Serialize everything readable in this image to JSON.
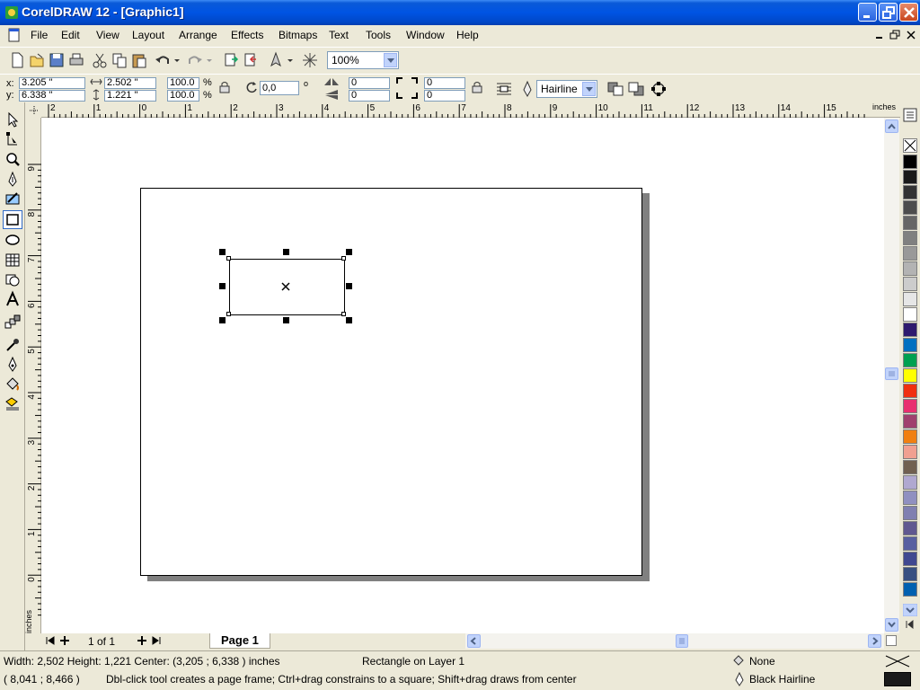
{
  "window": {
    "title": "CorelDRAW 12 - [Graphic1]"
  },
  "menu": [
    "File",
    "Edit",
    "View",
    "Layout",
    "Arrange",
    "Effects",
    "Bitmaps",
    "Text",
    "Tools",
    "Window",
    "Help"
  ],
  "toolbar": {
    "zoom": "100%"
  },
  "property_bar": {
    "x_label": "x:",
    "x": "3.205 \"",
    "y_label": "y:",
    "y": "6.338 \"",
    "width": "2.502 \"",
    "height": "1.221 \"",
    "scale_x": "100.0",
    "scale_y": "100.0",
    "percent": "%",
    "rotation": "0,0",
    "degree": "o",
    "corner_tl": "0",
    "corner_bl": "0",
    "corner_tr": "0",
    "corner_br": "0",
    "outline": "Hairline"
  },
  "rulers": {
    "unit": "inches",
    "h_ticks": [
      "2",
      "1",
      "0",
      "1",
      "2",
      "3",
      "4",
      "5",
      "6",
      "7",
      "8",
      "9",
      "10",
      "11",
      "12",
      "13",
      "14",
      "15"
    ],
    "v_ticks": [
      "9",
      "8",
      "7",
      "6",
      "5",
      "4",
      "3",
      "2",
      "1",
      "0"
    ]
  },
  "page_nav": {
    "count": "1 of 1",
    "tab": "Page 1"
  },
  "status": {
    "dimensions": "Width: 2,502  Height: 1,221  Center: (3,205 ; 6,338 )  inches",
    "object": "Rectangle on Layer 1",
    "cursor": "( 8,041 ; 8,466  )",
    "hint": "Dbl-click tool creates a page frame; Ctrl+drag constrains to a square; Shift+drag draws from center",
    "fill": "None",
    "outline": "Black  Hairline"
  },
  "palette_colors": [
    "#000000",
    "#1a1a1a",
    "#333333",
    "#4d4d4d",
    "#666666",
    "#808080",
    "#999999",
    "#b3b3b3",
    "#cccccc",
    "#e6e6e6",
    "#ffffff",
    "#2e1a6e",
    "#0070c0",
    "#00a050",
    "#ffff00",
    "#f03010",
    "#e83070",
    "#a0406e",
    "#f08010",
    "#f0a090",
    "#706050",
    "#b0a8d0",
    "#9090c0",
    "#8080b0",
    "#605890",
    "#5860a0",
    "#404890",
    "#385080",
    "#0060b0"
  ]
}
